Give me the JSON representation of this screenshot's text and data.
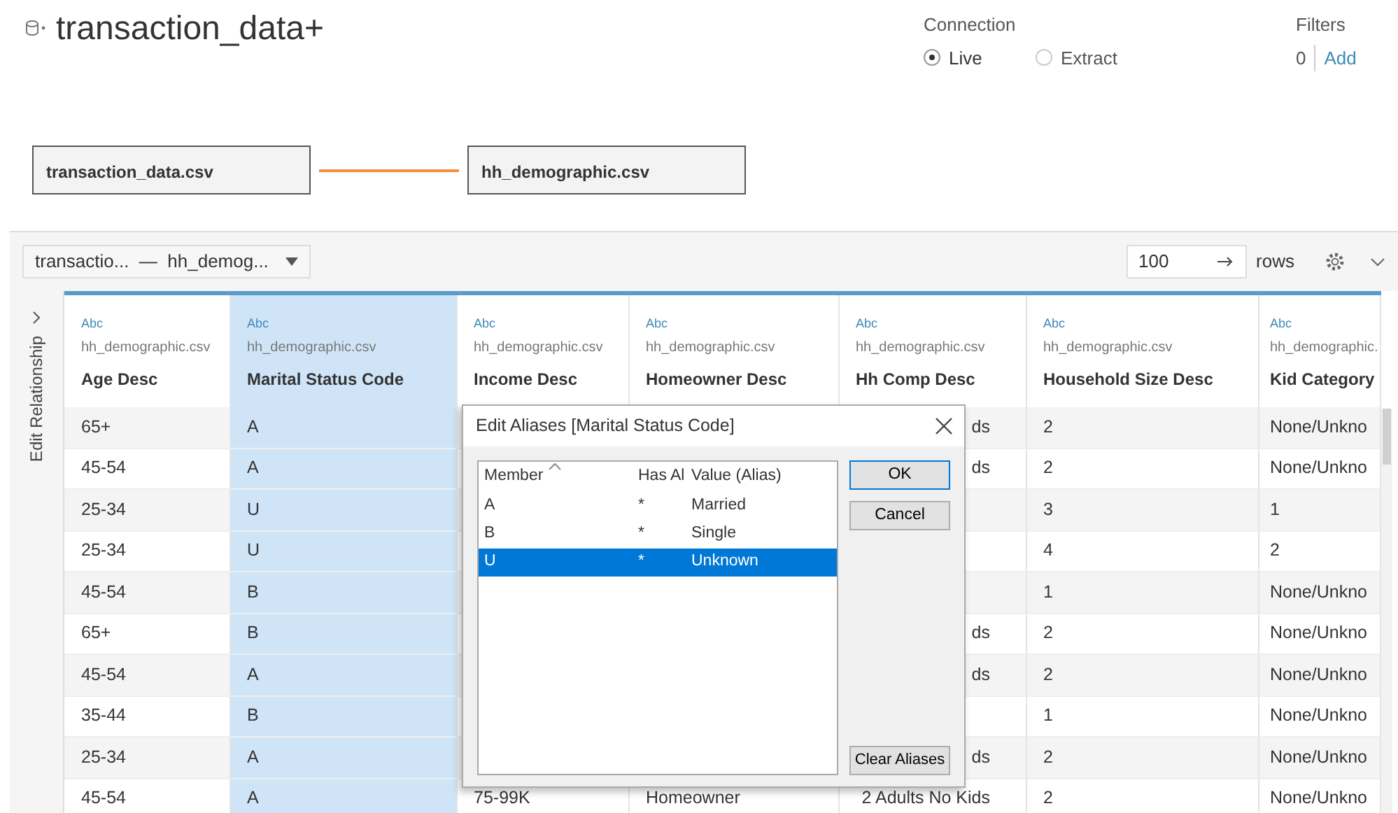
{
  "datasource": {
    "title": "transaction_data+"
  },
  "connection": {
    "label": "Connection",
    "options": [
      {
        "label": "Live",
        "selected": true
      },
      {
        "label": "Extract",
        "selected": false
      }
    ]
  },
  "filters": {
    "label": "Filters",
    "count": "0",
    "action": "Add"
  },
  "relationship": {
    "tables": [
      "transaction_data.csv",
      "hh_demographic.csv"
    ]
  },
  "toolbar": {
    "table_picker": "transactio...  —  hh_demog...",
    "row_count": "100",
    "rows_label": "rows"
  },
  "side_panel": {
    "label": "Edit Relationship"
  },
  "grid": {
    "columns": [
      {
        "type": "Abc",
        "source": "hh_demographic.csv",
        "name": "Age Desc",
        "selected": false
      },
      {
        "type": "Abc",
        "source": "hh_demographic.csv",
        "name": "Marital Status Code",
        "selected": true
      },
      {
        "type": "Abc",
        "source": "hh_demographic.csv",
        "name": "Income Desc",
        "selected": false
      },
      {
        "type": "Abc",
        "source": "hh_demographic.csv",
        "name": "Homeowner Desc",
        "selected": false
      },
      {
        "type": "Abc",
        "source": "hh_demographic.csv",
        "name": "Hh Comp Desc",
        "selected": false
      },
      {
        "type": "Abc",
        "source": "hh_demographic.csv",
        "name": "Household Size Desc",
        "selected": false
      },
      {
        "type": "Abc",
        "source": "hh_demographic.",
        "name": "Kid Category",
        "selected": false
      }
    ],
    "rows": [
      [
        "65+",
        "A",
        null,
        null,
        "ds",
        "2",
        "None/Unkno"
      ],
      [
        "45-54",
        "A",
        null,
        null,
        "ds",
        "2",
        "None/Unkno"
      ],
      [
        "25-34",
        "U",
        null,
        null,
        null,
        "3",
        "1"
      ],
      [
        "25-34",
        "U",
        null,
        null,
        null,
        "4",
        "2"
      ],
      [
        "45-54",
        "B",
        null,
        null,
        null,
        "1",
        "None/Unkno"
      ],
      [
        "65+",
        "B",
        null,
        null,
        "ds",
        "2",
        "None/Unkno"
      ],
      [
        "45-54",
        "A",
        null,
        null,
        "ds",
        "2",
        "None/Unkno"
      ],
      [
        "35-44",
        "B",
        null,
        null,
        null,
        "1",
        "None/Unkno"
      ],
      [
        "25-34",
        "A",
        null,
        null,
        "ds",
        "2",
        "None/Unkno"
      ],
      [
        "45-54",
        "A",
        "75-99K",
        "Homeowner",
        "2 Adults No Kids",
        "2",
        "None/Unkno"
      ]
    ]
  },
  "dialog": {
    "title": "Edit Aliases [Marital Status Code]",
    "columns": [
      "Member",
      "Has Al",
      "Value (Alias)"
    ],
    "rows": [
      {
        "member": "A",
        "has_alias": "*",
        "alias": "Married",
        "selected": false
      },
      {
        "member": "B",
        "has_alias": "*",
        "alias": "Single",
        "selected": false
      },
      {
        "member": "U",
        "has_alias": "*",
        "alias": "Unknown",
        "selected": true
      }
    ],
    "buttons": [
      "OK",
      "Cancel"
    ],
    "clear_button": "Clear Aliases"
  }
}
